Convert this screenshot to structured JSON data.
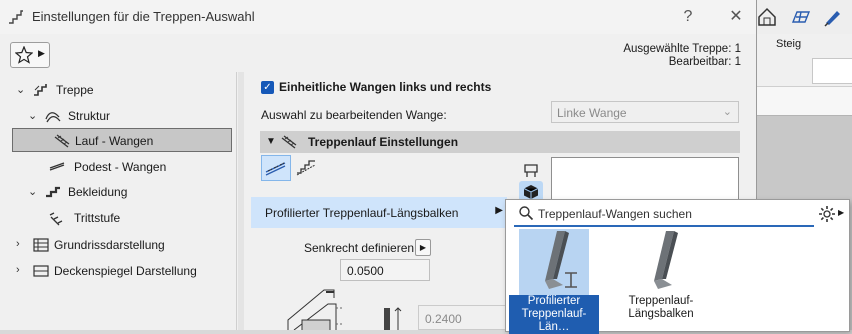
{
  "dialog": {
    "title": "Einstellungen für die Treppen-Auswahl",
    "help_label": "?",
    "close_label": "✕",
    "selected_stair": "Ausgewählte Treppe: 1",
    "editable": "Bearbeitbar: 1"
  },
  "tree": [
    {
      "label": "Treppe",
      "level": 0,
      "expanded": true,
      "selected": false,
      "icon": "stair-icon"
    },
    {
      "label": "Struktur",
      "level": 1,
      "expanded": true,
      "selected": false,
      "icon": "structure-icon"
    },
    {
      "label": "Lauf - Wangen",
      "level": 2,
      "selected": true,
      "icon": "flight-stringer-icon"
    },
    {
      "label": "Podest - Wangen",
      "level": 2,
      "selected": false,
      "icon": "landing-stringer-icon"
    },
    {
      "label": "Bekleidung",
      "level": 1,
      "expanded": true,
      "selected": false,
      "icon": "finish-icon"
    },
    {
      "label": "Trittstufe",
      "level": 2,
      "selected": false,
      "icon": "tread-icon"
    },
    {
      "label": "Grundrissdarstellung",
      "level": 0,
      "expanded": false,
      "selected": false,
      "icon": "floorplan-icon"
    },
    {
      "label": "Deckenspiegel Darstellung",
      "level": 0,
      "expanded": false,
      "selected": false,
      "icon": "ceiling-plan-icon"
    }
  ],
  "panel": {
    "uniform_stringers_label": "Einheitliche Wangen links und rechts",
    "uniform_stringers_checked": true,
    "edit_stringer_label": "Auswahl zu bearbeitenden Wange:",
    "edit_stringer_value": "Linke Wange",
    "section_title": "Treppenlauf Einstellungen",
    "profile_menu_label": "Profilierter Treppenlauf-Längsbalken",
    "vertical_label": "Senkrecht definieren",
    "value_1": "0.0500",
    "value_2": "0.2400"
  },
  "popup": {
    "search_placeholder": "Treppenlauf-Wangen suchen",
    "items": [
      {
        "label": "Profilierter Treppenlauf-Län…",
        "selected": true
      },
      {
        "label": "Treppenlauf-Längsbalken",
        "selected": false
      }
    ]
  },
  "background": {
    "panel_header": "Steig"
  },
  "colors": {
    "accent": "#1558b8",
    "selection": "#cfe4fb",
    "tile_selected": "#1f5db0"
  }
}
